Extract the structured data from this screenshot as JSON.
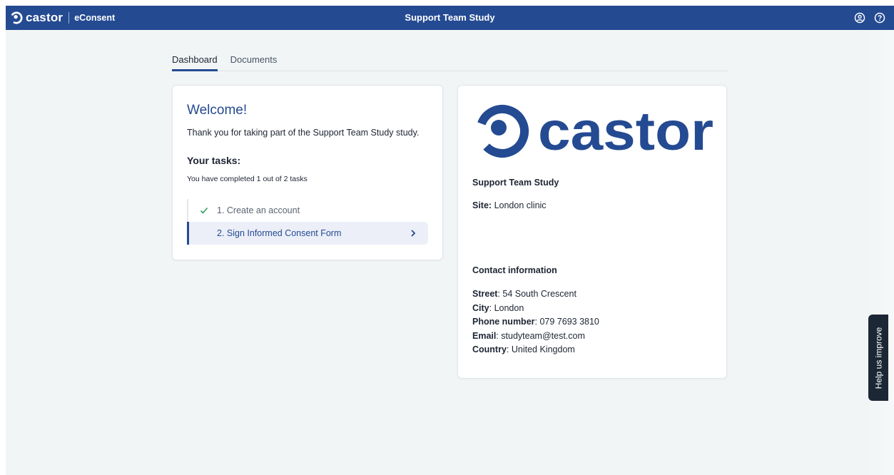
{
  "topbar": {
    "brand": "castor",
    "product": "eConsent",
    "title": "Support Team Study",
    "icons": [
      "account-icon",
      "help-icon"
    ]
  },
  "tabs": [
    {
      "label": "Dashboard",
      "active": true
    },
    {
      "label": "Documents",
      "active": false
    }
  ],
  "welcome_card": {
    "title": "Welcome!",
    "message": "Thank you for taking part of the Support Team Study study.",
    "tasks_heading": "Your tasks:",
    "tasks_progress": "You have completed 1 out of 2 tasks",
    "tasks": [
      {
        "label": "1. Create an account",
        "status": "completed"
      },
      {
        "label": "2. Sign Informed Consent Form",
        "status": "active"
      }
    ]
  },
  "study_card": {
    "logo_text": "castor",
    "study_name": "Support Team Study",
    "site_label": "Site:",
    "site_value": "London clinic",
    "contact_heading": "Contact information",
    "contact": {
      "street_label": "Street",
      "street_value": ": 54 South Crescent",
      "city_label": "City",
      "city_value": ": London",
      "phone_label": "Phone number",
      "phone_value": ": 079 7693 3810",
      "email_label": "Email",
      "email_value": ": studyteam@test.com",
      "country_label": "Country",
      "country_value": ": United Kingdom"
    }
  },
  "feedback_tab": {
    "label": "Help us improve"
  },
  "colors": {
    "brand": "#244a92",
    "background": "#f1f5f6",
    "feedback_tab": "#1c2735",
    "check": "#2e9e5b"
  }
}
